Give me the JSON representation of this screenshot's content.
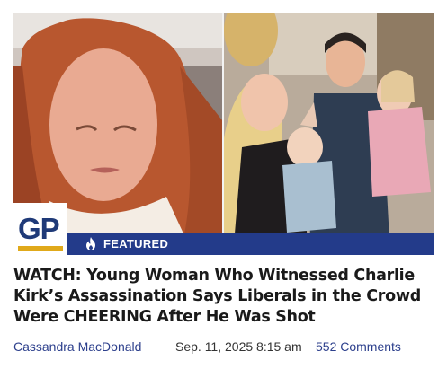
{
  "article": {
    "badge_text": "GP",
    "featured_label": "FEATURED",
    "title": "WATCH: Young Woman Who Witnessed Charlie Kirk’s Assassination Says Liberals in the Crowd Were CHEERING After He Was Shot",
    "author": "Cassandra MacDonald",
    "date": "Sep. 11, 2025 8:15 am",
    "comments": "552 Comments"
  },
  "colors": {
    "badge_blue": "#1f3a78",
    "badge_gold": "#e0a91a",
    "featured_bar": "#233b8a",
    "link": "#2c3f8c"
  },
  "icons": {
    "featured": "flame-icon"
  }
}
